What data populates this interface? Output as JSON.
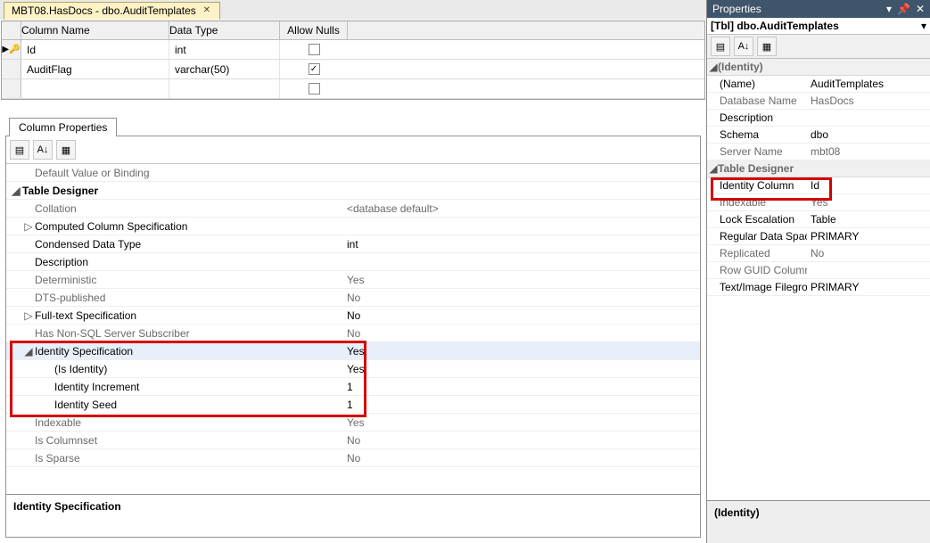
{
  "tab": {
    "title": "MBT08.HasDocs - dbo.AuditTemplates"
  },
  "columns": {
    "headers": {
      "name": "Column Name",
      "type": "Data Type",
      "nulls": "Allow Nulls"
    },
    "rows": [
      {
        "name": "Id",
        "type": "int",
        "allow_nulls": false,
        "key": true
      },
      {
        "name": "AuditFlag",
        "type": "varchar(50)",
        "allow_nulls": true,
        "key": false
      },
      {
        "name": "",
        "type": "",
        "allow_nulls": false,
        "key": false
      }
    ]
  },
  "column_properties": {
    "tab_label": "Column Properties",
    "rows": [
      {
        "label": "Default Value or Binding",
        "value": "",
        "indent": 1,
        "dim": true
      },
      {
        "label": "Table Designer",
        "value": "",
        "indent": 0,
        "expander": "collapse",
        "bold": true
      },
      {
        "label": "Collation",
        "value": "<database default>",
        "indent": 1,
        "dim": true
      },
      {
        "label": "Computed Column Specification",
        "value": "",
        "indent": 1,
        "expander": "expand"
      },
      {
        "label": "Condensed Data Type",
        "value": "int",
        "indent": 1
      },
      {
        "label": "Description",
        "value": "",
        "indent": 1
      },
      {
        "label": "Deterministic",
        "value": "Yes",
        "indent": 1,
        "dim": true
      },
      {
        "label": "DTS-published",
        "value": "No",
        "indent": 1,
        "dim": true
      },
      {
        "label": "Full-text Specification",
        "value": "No",
        "indent": 1,
        "expander": "expand"
      },
      {
        "label": "Has Non-SQL Server Subscriber",
        "value": "No",
        "indent": 1,
        "dim": true
      },
      {
        "label": "Identity Specification",
        "value": "Yes",
        "indent": 1,
        "expander": "collapse",
        "sel": true
      },
      {
        "label": "(Is Identity)",
        "value": "Yes",
        "indent": 2
      },
      {
        "label": "Identity Increment",
        "value": "1",
        "indent": 2
      },
      {
        "label": "Identity Seed",
        "value": "1",
        "indent": 2
      },
      {
        "label": "Indexable",
        "value": "Yes",
        "indent": 1,
        "dim": true
      },
      {
        "label": "Is Columnset",
        "value": "No",
        "indent": 1,
        "dim": true
      },
      {
        "label": "Is Sparse",
        "value": "No",
        "indent": 1,
        "dim": true
      }
    ],
    "desc": "Identity Specification"
  },
  "properties": {
    "title": "Properties",
    "selector": "[Tbl] dbo.AuditTemplates",
    "groups": [
      {
        "name": "(Identity)",
        "rows": [
          {
            "label": "(Name)",
            "value": "AuditTemplates"
          },
          {
            "label": "Database Name",
            "value": "HasDocs",
            "dim": true
          },
          {
            "label": "Description",
            "value": ""
          },
          {
            "label": "Schema",
            "value": "dbo"
          },
          {
            "label": "Server Name",
            "value": "mbt08",
            "dim": true
          }
        ]
      },
      {
        "name": "Table Designer",
        "rows": [
          {
            "label": "Identity Column",
            "value": "Id",
            "highlight": true
          },
          {
            "label": "Indexable",
            "value": "Yes",
            "dim": true
          },
          {
            "label": "Lock Escalation",
            "value": "Table"
          },
          {
            "label": "Regular Data Space Specification",
            "value": "PRIMARY"
          },
          {
            "label": "Replicated",
            "value": "No",
            "dim": true
          },
          {
            "label": "Row GUID Column",
            "value": "",
            "dim": true
          },
          {
            "label": "Text/Image Filegroup",
            "value": "PRIMARY"
          }
        ]
      }
    ],
    "desc": "(Identity)"
  }
}
